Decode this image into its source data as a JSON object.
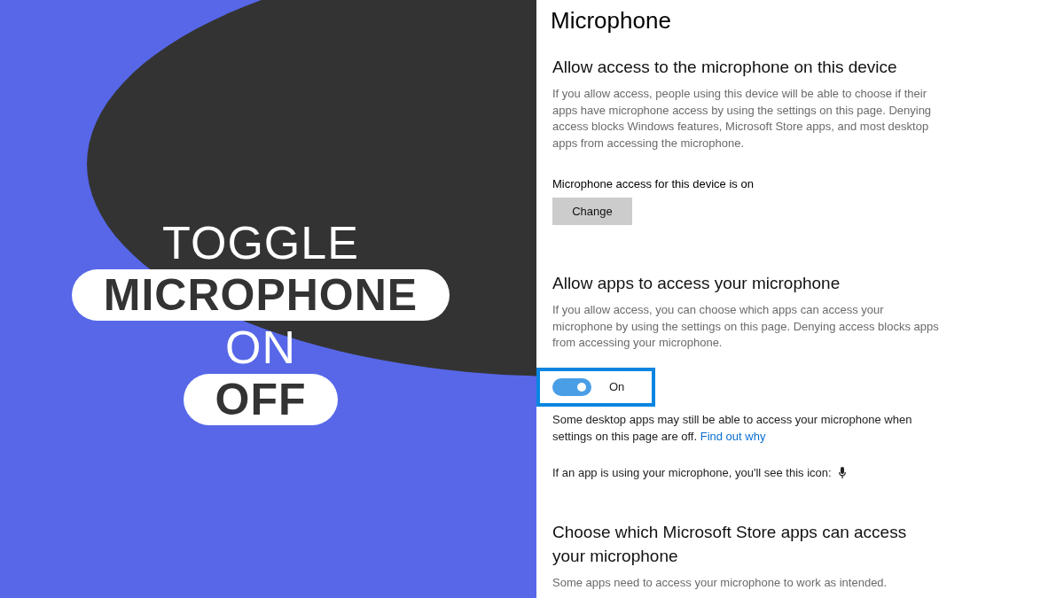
{
  "banner": {
    "lines": [
      {
        "text": "TOGGLE",
        "kind": "plain"
      },
      {
        "text": "MICROPHONE",
        "kind": "pill"
      },
      {
        "text": "ON",
        "kind": "plain"
      },
      {
        "text": "OFF",
        "kind": "pill"
      }
    ]
  },
  "settings": {
    "title": "Microphone",
    "blocks": [
      {
        "kind": "heading",
        "text": "Allow access to the microphone on this device"
      },
      {
        "kind": "paragraph",
        "text": "If you allow access, people using this device will be able to choose if their apps have microphone access by using the settings on this page. Denying access blocks Windows features, Microsoft Store apps, and most desktop apps from accessing the microphone."
      },
      {
        "kind": "label",
        "text": "Microphone access for this device is on"
      },
      {
        "kind": "button",
        "text": "Change"
      },
      {
        "kind": "heading",
        "text": "Allow apps to access your microphone"
      },
      {
        "kind": "paragraph",
        "text": "If you allow access, you can choose which apps can access your microphone by using the settings on this page. Denying access blocks apps from accessing your microphone."
      },
      {
        "kind": "toggle",
        "text": "On",
        "on": true,
        "focused": true
      },
      {
        "kind": "note",
        "text": "Some desktop apps may still be able to access your microphone when settings on this page are off.",
        "link": "Find out why"
      },
      {
        "kind": "icon-line",
        "text": "If an app is using your microphone, you'll see this icon:"
      },
      {
        "kind": "heading",
        "text": "Choose which Microsoft Store apps can access your microphone"
      },
      {
        "kind": "paragraph",
        "text": "Some apps need to access your microphone to work as intended."
      }
    ]
  }
}
